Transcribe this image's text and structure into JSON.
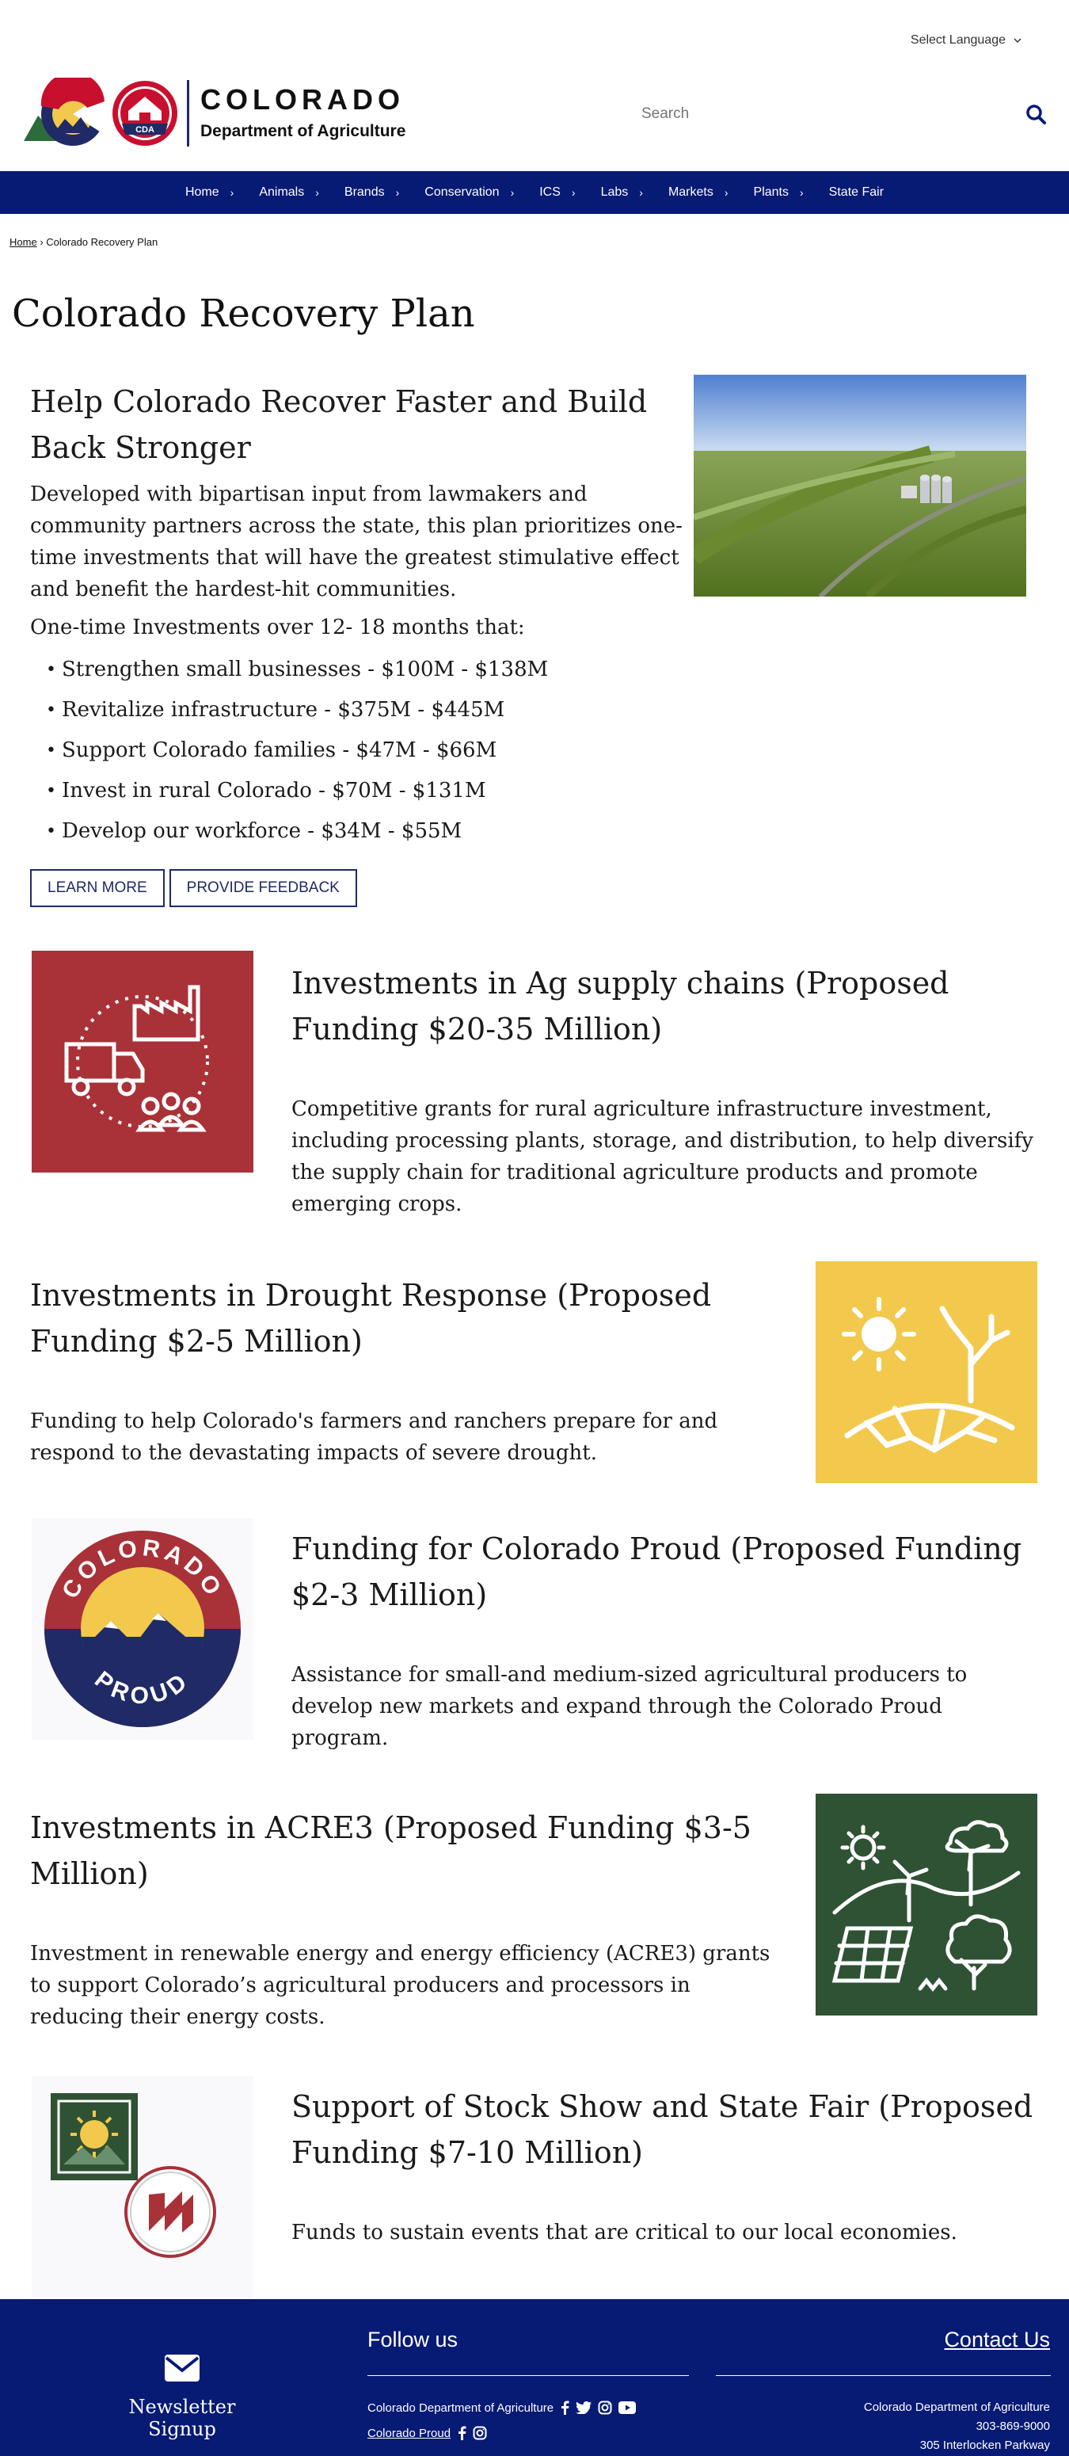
{
  "header": {
    "language_label": "Select Language",
    "logo_line1": "COLORADO",
    "logo_line2": "Department of Agriculture",
    "logo_badge_text": "CDA",
    "search_placeholder": "Search"
  },
  "nav": [
    {
      "label": "Home"
    },
    {
      "label": "Animals"
    },
    {
      "label": "Brands"
    },
    {
      "label": "Conservation"
    },
    {
      "label": "ICS"
    },
    {
      "label": "Labs"
    },
    {
      "label": "Markets"
    },
    {
      "label": "Plants"
    },
    {
      "label": "State Fair"
    }
  ],
  "breadcrumb": {
    "home": "Home",
    "sep": "›",
    "current": "Colorado Recovery Plan"
  },
  "page_title": "Colorado Recovery Plan",
  "hero": {
    "heading": "Help Colorado Recover Faster and Build Back Stronger",
    "body": "Developed with bipartisan input from lawmakers and community partners across the state, this plan prioritizes one-time investments that will have the greatest stimulative effect and benefit the hardest-hit communities.",
    "subheading": "One-time Investments over 12- 18 months that:",
    "items": [
      "Strengthen small businesses - $100M - $138M",
      "Revitalize infrastructure - $375M - $445M",
      "Support Colorado families - $47M - $66M",
      "Invest in rural Colorado - $70M - $131M",
      "Develop our workforce - $34M - $55M"
    ],
    "learn_more": "LEARN MORE",
    "feedback": "PROVIDE FEEDBACK"
  },
  "sections": [
    {
      "heading": "Investments in Ag supply chains (Proposed Funding $20-35 Million)",
      "body": "Competitive grants for rural agriculture infrastructure investment, including processing plants, storage, and distribution, to help diversify the supply chain for traditional agriculture products and promote emerging crops."
    },
    {
      "heading": "Investments in Drought Response (Proposed Funding $2-5 Million)",
      "body": "Funding to help Colorado's farmers and ranchers prepare for and respond to the devastating impacts of severe drought."
    },
    {
      "heading": "Funding for Colorado Proud (Proposed Funding $2-3 Million)",
      "body": "Assistance for small-and medium-sized agricultural producers to develop new markets and expand through the Colorado Proud program."
    },
    {
      "heading": "Investments in ACRE3 (Proposed Funding $3-5 Million)",
      "body": "Investment in renewable energy and energy efficiency (ACRE3) grants to support Colorado’s agricultural producers and processors in reducing their energy costs."
    },
    {
      "heading": "Support of Stock Show and State Fair (Proposed Funding $7-10 Million)",
      "body": "Funds to sustain events that are critical to our local economies."
    }
  ],
  "proud_logo": {
    "top": "COLORADO",
    "bottom": "PROUD"
  },
  "footer": {
    "newsletter": "Newsletter Signup",
    "follow": "Follow us",
    "contact": "Contact Us",
    "org1": "Colorado Department of Agriculture",
    "org2": "Colorado Proud",
    "addr_name": "Colorado Department of Agriculture",
    "phone": "303-869-9000",
    "street": "305 Interlocken Parkway"
  },
  "colors": {
    "navy": "#071a74",
    "red": "#a93138",
    "gold": "#f2c94c",
    "green": "#2e5233"
  }
}
